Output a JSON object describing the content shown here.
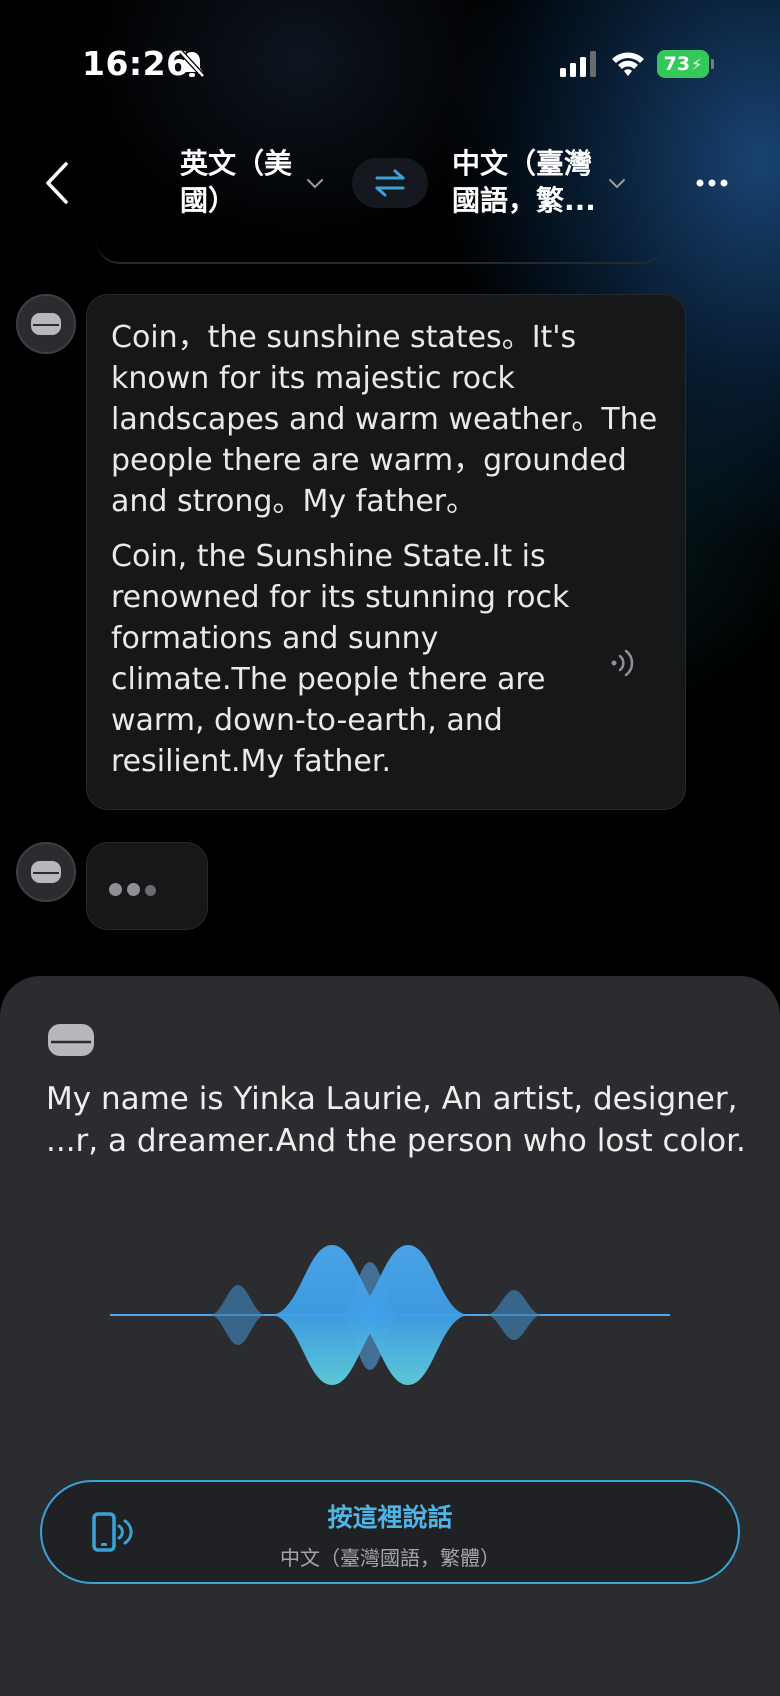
{
  "status_bar": {
    "time": "16:26",
    "battery": "73"
  },
  "header": {
    "source_lang": "英文（美國）",
    "target_lang": "中文（臺灣國語，繁...",
    "icons": [
      "back-icon",
      "chevron-down-icon",
      "swap-icon",
      "more-icon"
    ]
  },
  "messages": [
    {
      "source": "Coin，the sunshine states。It's known for its majestic rock landscapes and warm weather。The people there are warm，grounded and strong。My father。",
      "translation": "Coin, the Sunshine State.It is renowned for its stunning rock formations and sunny climate.The people there are warm, down-to-earth, and resilient.My father."
    },
    {
      "status": "typing"
    }
  ],
  "live_panel": {
    "transcript": "My name is Yinka Laurie, An artist, designer, ...r, a dreamer.And the person who lost color."
  },
  "talk_button": {
    "label": "按這裡說話",
    "sublabel": "中文（臺灣國語，繁體）"
  },
  "colors": {
    "accent": "#3aa3d6",
    "background": "#000000",
    "panel": "#2b2c2f",
    "bubble": "#151719",
    "battery": "#34c759"
  }
}
